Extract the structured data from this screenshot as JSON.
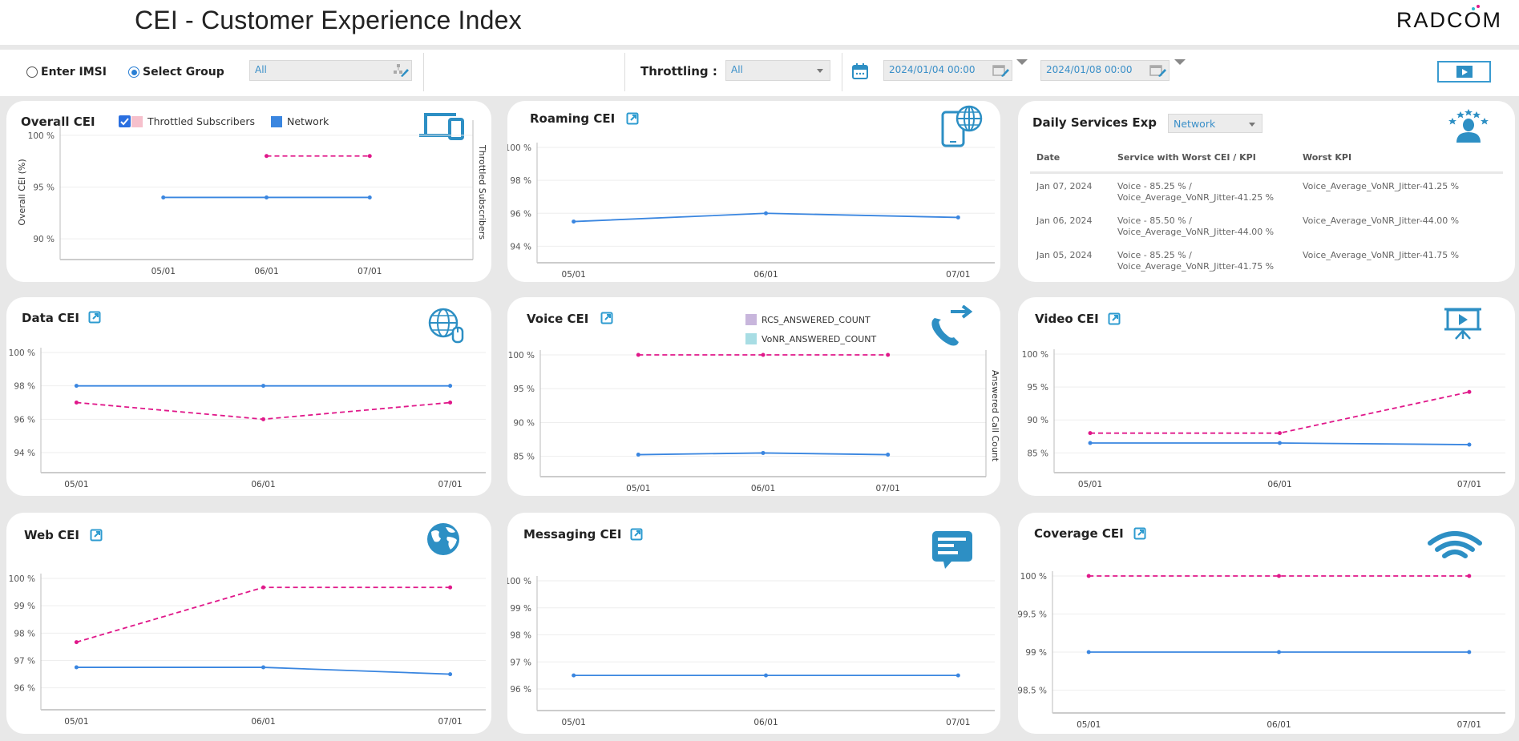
{
  "header": {
    "title": "CEI - Customer Experience Index",
    "logo": "RADCOM"
  },
  "toolbar": {
    "radio_imsi": "Enter IMSI",
    "radio_group": "Select Group",
    "selected_mode": "group",
    "group_value": "All",
    "throttling_label": "Throttling :",
    "throttling_value": "All",
    "date_from": "2024/01/04 00:00",
    "date_to": "2024/01/08 00:00",
    "run_icon": "play-icon"
  },
  "colors": {
    "network": "#3a86e0",
    "throttled": "#e0188a",
    "accent": "#2d8fc4",
    "legend_throttled": "#f6c0cc",
    "legend_network": "#3a86e0",
    "legend_rcs": "#c8b6dc",
    "legend_vonr": "#a8dde4"
  },
  "overall": {
    "title": "Overall CEI",
    "legend": [
      {
        "label": "Throttled Subscribers",
        "checked": true
      },
      {
        "label": "Network"
      }
    ],
    "icon": "devices-icon"
  },
  "daily": {
    "title": "Daily Services Exp",
    "select_value": "Network",
    "icon": "customer-rating-icon",
    "columns": [
      "Date",
      "Service with Worst CEI / KPI",
      "Worst KPI"
    ],
    "rows": [
      {
        "date": "Jan 07, 2024",
        "service_line1": "Voice - 85.25 % /",
        "service_line2": "Voice_Average_VoNR_Jitter-41.25 %",
        "worst": "Voice_Average_VoNR_Jitter-41.25 %"
      },
      {
        "date": "Jan 06, 2024",
        "service_line1": "Voice - 85.50 % /",
        "service_line2": "Voice_Average_VoNR_Jitter-44.00 %",
        "worst": "Voice_Average_VoNR_Jitter-44.00 %"
      },
      {
        "date": "Jan 05, 2024",
        "service_line1": "Voice - 85.25 % /",
        "service_line2": "Voice_Average_VoNR_Jitter-41.75 %",
        "worst": "Voice_Average_VoNR_Jitter-41.75 %"
      }
    ]
  },
  "voice_legend": [
    "RCS_ANSWERED_COUNT",
    "VoNR_ANSWERED_COUNT"
  ],
  "chart_data": [
    {
      "id": "overall",
      "type": "line",
      "title": "Overall CEI",
      "ylabel": "Overall CEI (%)",
      "y2label": "Throttled Subscribers",
      "categories": [
        "05/01",
        "06/01",
        "07/01"
      ],
      "yticks": [
        90,
        95,
        100
      ],
      "ylim": [
        88,
        101
      ],
      "tick_suffix": " %",
      "series": [
        {
          "name": "Network",
          "values": [
            94,
            94,
            94
          ]
        },
        {
          "name": "Throttled Subscribers",
          "values": [
            null,
            98,
            98
          ]
        }
      ]
    },
    {
      "id": "roaming",
      "type": "line",
      "title": "Roaming CEI",
      "categories": [
        "05/01",
        "06/01",
        "07/01"
      ],
      "yticks": [
        94,
        96,
        98,
        100
      ],
      "ylim": [
        93,
        100
      ],
      "tick_suffix": " %",
      "series": [
        {
          "name": "Network",
          "values": [
            95.5,
            96,
            95.75
          ]
        }
      ]
    },
    {
      "id": "data",
      "type": "line",
      "title": "Data CEI",
      "categories": [
        "05/01",
        "06/01",
        "07/01"
      ],
      "yticks": [
        94,
        96,
        98,
        100
      ],
      "ylim": [
        92.8,
        100
      ],
      "tick_suffix": " %",
      "series": [
        {
          "name": "Network",
          "values": [
            98,
            98,
            98
          ]
        },
        {
          "name": "Throttled Subscribers",
          "values": [
            97,
            96,
            97
          ]
        }
      ]
    },
    {
      "id": "voice",
      "type": "line",
      "title": "Voice CEI",
      "y2label": "Answered Call Count",
      "categories": [
        "05/01",
        "06/01",
        "07/01"
      ],
      "yticks": [
        85,
        90,
        95,
        100
      ],
      "ylim": [
        82,
        100
      ],
      "tick_suffix": " %",
      "series": [
        {
          "name": "Network",
          "values": [
            85.25,
            85.5,
            85.25
          ]
        },
        {
          "name": "Throttled Subscribers",
          "values": [
            100,
            100,
            100
          ]
        }
      ]
    },
    {
      "id": "video",
      "type": "line",
      "title": "Video CEI",
      "categories": [
        "05/01",
        "06/01",
        "07/01"
      ],
      "yticks": [
        85,
        90,
        95,
        100
      ],
      "ylim": [
        82,
        100
      ],
      "tick_suffix": " %",
      "series": [
        {
          "name": "Network",
          "values": [
            86.5,
            86.5,
            86.25
          ]
        },
        {
          "name": "Throttled Subscribers",
          "values": [
            88,
            88,
            94.25
          ]
        }
      ]
    },
    {
      "id": "web",
      "type": "line",
      "title": "Web CEI",
      "categories": [
        "05/01",
        "06/01",
        "07/01"
      ],
      "yticks": [
        96,
        97,
        98,
        99,
        100
      ],
      "ylim": [
        95.2,
        100
      ],
      "tick_suffix": " %",
      "series": [
        {
          "name": "Network",
          "values": [
            96.75,
            96.75,
            96.5
          ]
        },
        {
          "name": "Throttled Subscribers",
          "values": [
            97.67,
            99.67,
            99.67
          ]
        }
      ]
    },
    {
      "id": "messaging",
      "type": "line",
      "title": "Messaging CEI",
      "categories": [
        "05/01",
        "06/01",
        "07/01"
      ],
      "yticks": [
        96,
        97,
        98,
        99,
        100
      ],
      "ylim": [
        95.2,
        100
      ],
      "tick_suffix": " %",
      "series": [
        {
          "name": "Network",
          "values": [
            96.5,
            96.5,
            96.5
          ]
        }
      ]
    },
    {
      "id": "coverage",
      "type": "line",
      "title": "Coverage CEI",
      "categories": [
        "05/01",
        "06/01",
        "07/01"
      ],
      "yticks": [
        98.5,
        99,
        99.5,
        100
      ],
      "ylim": [
        98.2,
        100
      ],
      "tick_suffix": " %",
      "series": [
        {
          "name": "Network",
          "values": [
            99,
            99,
            99
          ]
        },
        {
          "name": "Throttled Subscribers",
          "values": [
            100,
            100,
            100
          ]
        }
      ]
    }
  ]
}
